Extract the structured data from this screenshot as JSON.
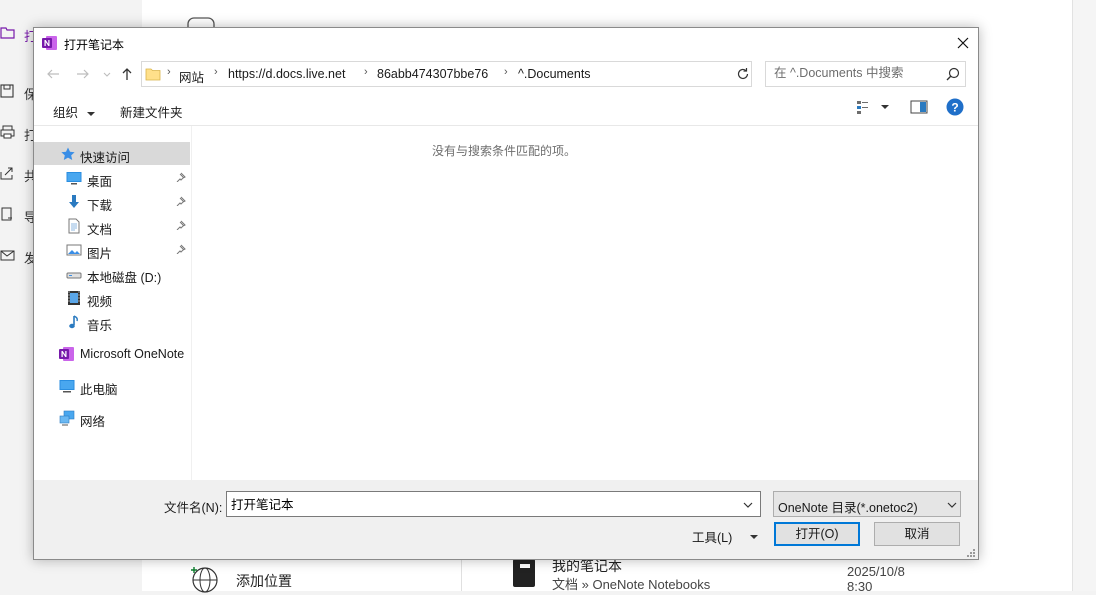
{
  "background": {
    "nav_items": [
      {
        "label": "打",
        "icon": "folder-open-icon"
      },
      {
        "label": "保",
        "icon": "save-icon"
      },
      {
        "label": "打",
        "icon": "print-icon"
      },
      {
        "label": "共",
        "icon": "share-icon"
      },
      {
        "label": "导",
        "icon": "export-icon"
      },
      {
        "label": "发",
        "icon": "send-icon"
      }
    ],
    "add_location_label": "添加位置",
    "notebook_name": "我的笔记本",
    "notebook_path": "文档 » OneNote Notebooks",
    "notebook_date": "2025/10/8 8:30"
  },
  "dialog": {
    "title": "打开笔记本",
    "breadcrumbs": [
      "网站",
      "https://d.docs.live.net",
      "86abb474307bbe76",
      "^.Documents"
    ],
    "search_placeholder": "在 ^.Documents 中搜索",
    "toolbar": {
      "organize_label": "组织",
      "new_folder_label": "新建文件夹"
    },
    "nav": {
      "quick_access": "快速访问",
      "quick_items": [
        {
          "label": "桌面",
          "icon": "desktop-icon",
          "pinned": true
        },
        {
          "label": "下载",
          "icon": "download-icon",
          "pinned": true
        },
        {
          "label": "文档",
          "icon": "document-icon",
          "pinned": true
        },
        {
          "label": "图片",
          "icon": "pictures-icon",
          "pinned": true
        },
        {
          "label": "本地磁盘 (D:)",
          "icon": "drive-icon",
          "pinned": false
        },
        {
          "label": "视频",
          "icon": "video-icon",
          "pinned": false
        },
        {
          "label": "音乐",
          "icon": "music-icon",
          "pinned": false
        }
      ],
      "onenote": "Microsoft OneNote",
      "this_pc": "此电脑",
      "network": "网络"
    },
    "empty_message": "没有与搜索条件匹配的项。",
    "footer": {
      "filename_label": "文件名(N):",
      "filename_value": "打开笔记本",
      "filetype": "OneNote 目录(*.onetoc2)",
      "tools_label": "工具(L)",
      "open_label": "打开(O)",
      "cancel_label": "取消"
    }
  },
  "colors": {
    "onenote_purple": "#7719aa",
    "accent_blue": "#0078d7",
    "selection_gray": "#d9d9d9"
  }
}
